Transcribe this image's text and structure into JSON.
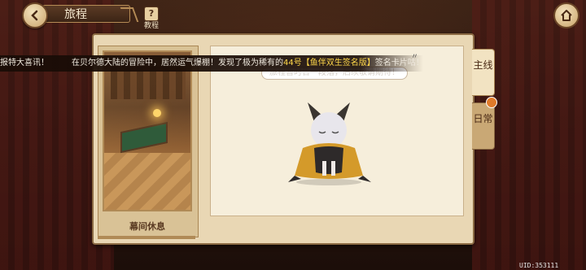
{
  "header": {
    "title": "旅程",
    "tutorial_label": "教程",
    "tutorial_badge": "?"
  },
  "notice": {
    "prefix": "报特大喜讯！",
    "message_before": "在贝尔德大陆的冒险中，居然运气爆棚！发现了极为稀有的",
    "highlight": "44号【鱼伴双生签名版】",
    "message_after": "签名卡片咕！"
  },
  "left_card": {
    "label": "幕间休息"
  },
  "speech": {
    "text": "旅程暂时告一段落，后续敬请期待！"
  },
  "tabs": {
    "main": "主线",
    "daily": "日常"
  },
  "footer": {
    "uid": "UID:353111"
  },
  "colors": {
    "highlight": "#ffd84a",
    "panel": "#e9d7b4",
    "frame": "#8b6a43"
  },
  "icons": {
    "back": "back-arrow-icon",
    "home": "home-icon",
    "tutorial": "question-icon"
  }
}
